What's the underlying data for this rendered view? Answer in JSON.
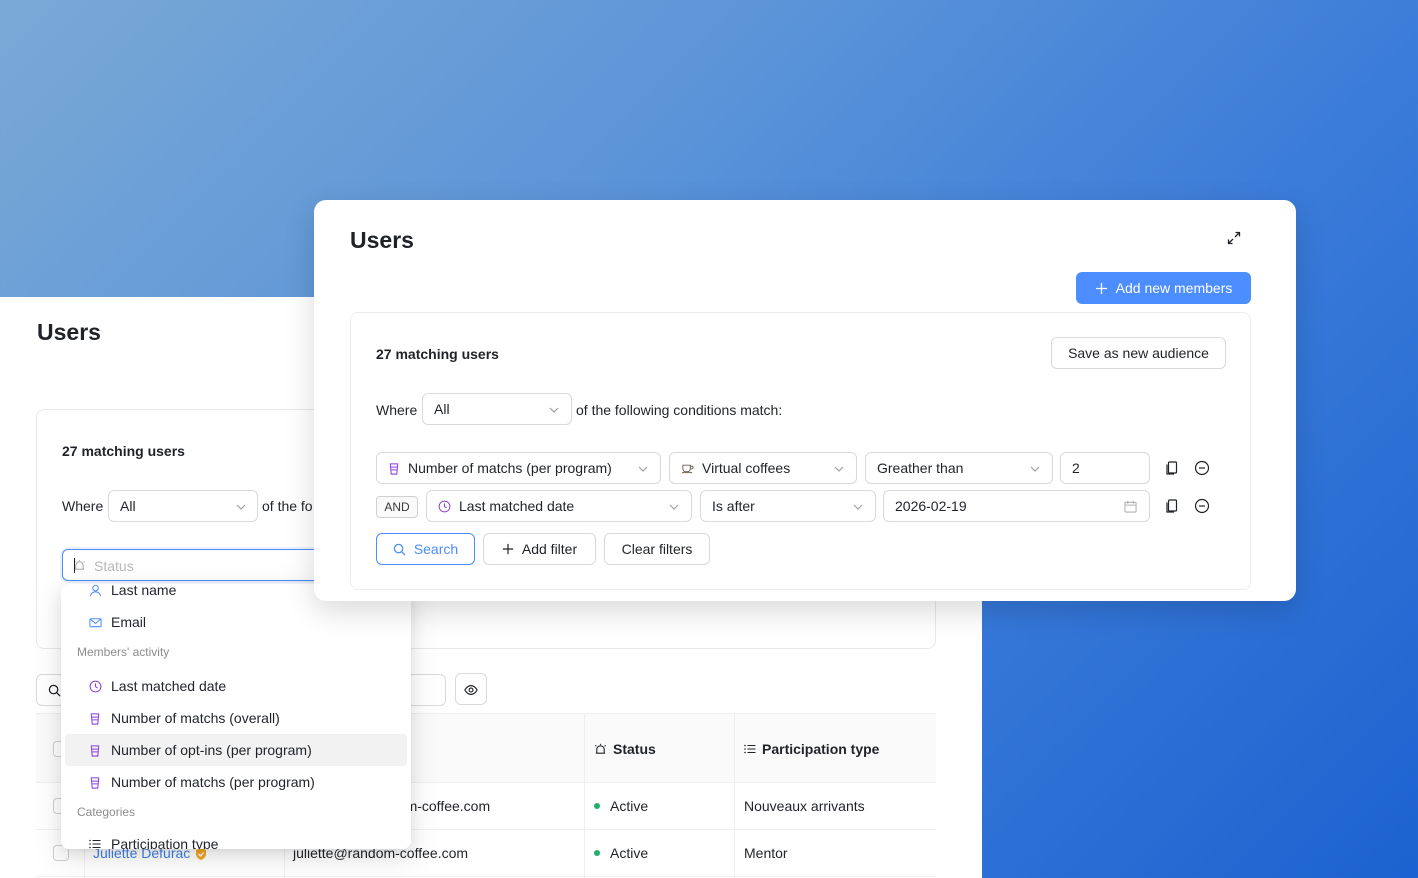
{
  "background": {
    "title": "Users",
    "matching": "27 matching users",
    "where_label": "Where",
    "where_value": "All",
    "of_the": "of the fo",
    "status_placeholder": "Status",
    "table": {
      "headers": {
        "status": "Status",
        "participation": "Participation type"
      },
      "rows": [
        {
          "name": "",
          "email": "dom-coffee.com",
          "status": "Active",
          "participation": "Nouveaux arrivants"
        },
        {
          "name": "Juliette Defurac",
          "email": "juliette@random-coffee.com",
          "status": "Active",
          "participation": "Mentor"
        }
      ]
    }
  },
  "dropdown": {
    "items_top": [
      {
        "label": "Last name",
        "icon": "user-icon"
      },
      {
        "label": "Email",
        "icon": "mail-icon"
      }
    ],
    "group_activity": "Members' activity",
    "activity_items": [
      {
        "label": "Last matched date",
        "icon": "clock-icon"
      },
      {
        "label": "Number of matchs (overall)",
        "icon": "cup-icon"
      },
      {
        "label": "Number of opt-ins (per program)",
        "icon": "cup-icon"
      },
      {
        "label": "Number of matchs (per program)",
        "icon": "cup-icon"
      }
    ],
    "group_categories": "Categories",
    "category_items": [
      {
        "label": "Participation type",
        "icon": "list-icon"
      }
    ]
  },
  "modal": {
    "title": "Users",
    "add_members": "Add new members",
    "matching": "27 matching users",
    "save_audience": "Save as new audience",
    "where_label": "Where",
    "where_value": "All",
    "conditions_text": "of the following conditions match:",
    "filters": [
      {
        "field": "Number of matchs (per program)",
        "program": "Virtual coffees",
        "operator": "Greather than",
        "value": "2"
      },
      {
        "connector": "AND",
        "field": "Last matched date",
        "operator": "Is after",
        "value": "2026-02-19"
      }
    ],
    "search_btn": "Search",
    "add_filter_btn": "Add filter",
    "clear_filters_btn": "Clear filters"
  },
  "colors": {
    "accent": "#4c8dff",
    "purple_icon": "#8b3fd9",
    "active_dot": "#20b26c"
  }
}
